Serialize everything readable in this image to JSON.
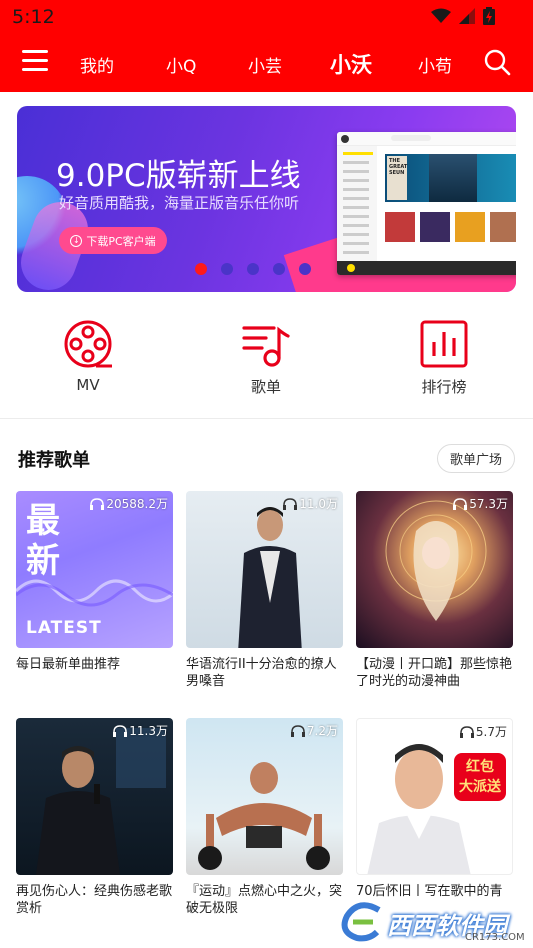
{
  "status": {
    "time": "5:12"
  },
  "nav": {
    "tabs": [
      {
        "label": "我的"
      },
      {
        "label": "小Q"
      },
      {
        "label": "小芸"
      },
      {
        "label": "小沃",
        "active": true
      },
      {
        "label": "小苟"
      }
    ]
  },
  "banner": {
    "title": "9.0PC版崭新上线",
    "subtitle": "好音质用酷我，海量正版音乐任你听",
    "button": "下载PC客户端",
    "active_dot": 0,
    "dot_count": 5
  },
  "quick": {
    "mv": "MV",
    "playlist": "歌单",
    "chart": "排行榜"
  },
  "section": {
    "title": "推荐歌单",
    "more": "歌单广场"
  },
  "cards": [
    {
      "count": "20588.2万",
      "name": "每日最新单曲推荐",
      "cover_text_1": "最",
      "cover_text_2": "新",
      "cover_text_3": "LATEST"
    },
    {
      "count": "11.0万",
      "name": "华语流行II十分治愈的撩人男嗓音"
    },
    {
      "count": "57.3万",
      "name": "【动漫丨开口跪】那些惊艳了时光的动漫神曲"
    },
    {
      "count": "11.3万",
      "name": "再见伤心人：经典伤感老歌赏析"
    },
    {
      "count": "7.2万",
      "name": "『运动』点燃心中之火，突破无极限"
    },
    {
      "count": "5.7万",
      "name": "70后怀旧丨写在歌中的青",
      "cover_badge": "红包\n大派送"
    }
  ],
  "watermark": {
    "text": "西西软件园",
    "url": "CR173.COM"
  },
  "colors": {
    "brand": "#ff0000",
    "accent": "#e8001a"
  }
}
